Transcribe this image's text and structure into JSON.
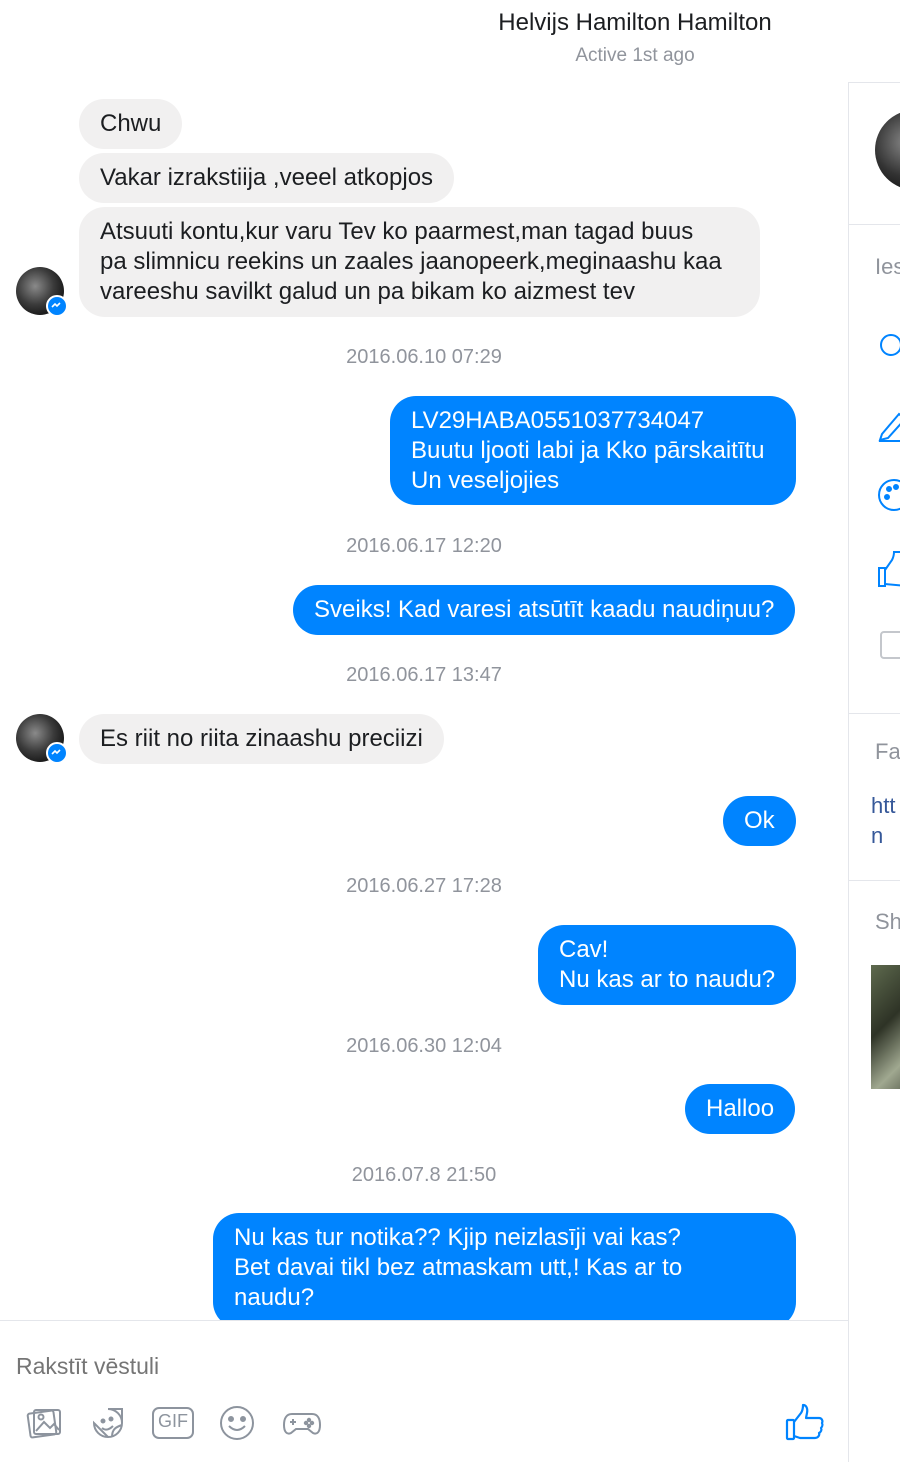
{
  "header": {
    "contact_name": "Helvijs Hamilton Hamilton",
    "status": "Active 1st ago"
  },
  "messages": [
    {
      "from": "them",
      "text": "Chwu"
    },
    {
      "from": "them",
      "text": "Vakar izrakstiija ,veeel atkopjos"
    },
    {
      "from": "them",
      "text": "Atsuuti kontu,kur varu Tev ko paarmest,man tagad buus\npa slimnicu reekins un zaales jaanopeerk,meginaashu kaa\nvareeshu savilkt galud un pa bikam ko aizmest tev"
    },
    {
      "timestamp": "2016.06.10 07:29"
    },
    {
      "from": "me",
      "text": "LV29HABA0551037734047\nBuutu ljooti labi ja Kko pārskaitītu\nUn veseljojies"
    },
    {
      "timestamp": "2016.06.17 12:20"
    },
    {
      "from": "me",
      "text": "Sveiks! Kad varesi atsūtīt kaadu naudiņuu?"
    },
    {
      "timestamp": "2016.06.17 13:47"
    },
    {
      "from": "them",
      "text": "Es riit no riita zinaashu preciizi"
    },
    {
      "from": "me",
      "text": "Ok"
    },
    {
      "timestamp": "2016.06.27 17:28"
    },
    {
      "from": "me",
      "text": "Cav!\nNu kas ar to naudu?"
    },
    {
      "timestamp": "2016.06.30 12:04"
    },
    {
      "from": "me",
      "text": "Halloo"
    },
    {
      "timestamp": "2016.07.8 21:50"
    },
    {
      "from": "me",
      "text": "Nu kas tur notika?? Kjip neizlasīji vai kas?\nBet davai tikl bez atmaskam utt,! Kas ar to\nnaudu?"
    }
  ],
  "composer": {
    "placeholder": "Rakstīt vēstuli",
    "tools": [
      "photo-icon",
      "sticker-icon",
      "gif-icon",
      "emoji-icon",
      "game-controller-icon"
    ],
    "gif_label": "GIF",
    "send_icon": "thumbs-up-icon"
  },
  "right_panel": {
    "options_label": "Ies",
    "facebook_label": "Fa",
    "link_text": "htt\nn",
    "shared_label": "Sh"
  },
  "colors": {
    "accent": "#0084ff",
    "incoming_bubble": "#f1f0f0",
    "muted_text": "#90949c"
  }
}
